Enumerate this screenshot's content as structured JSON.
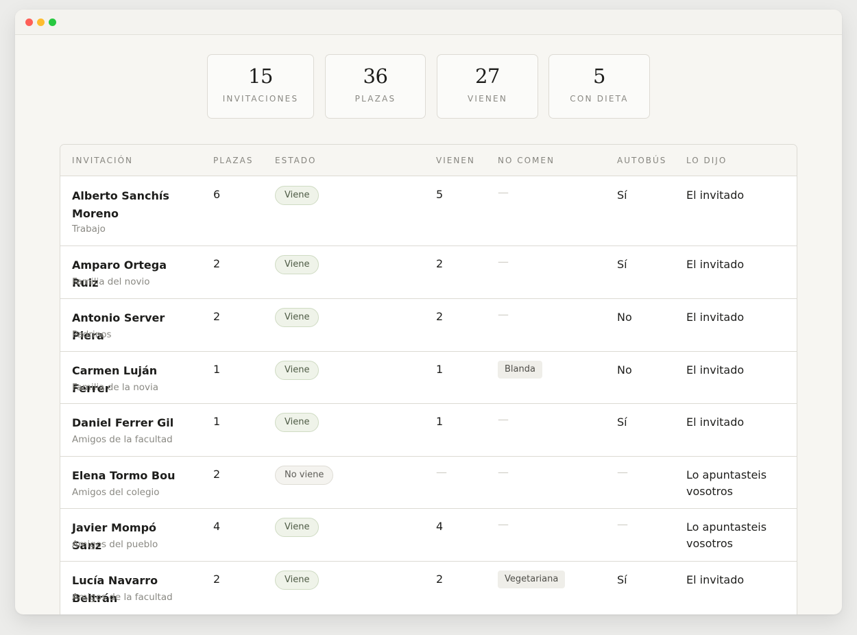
{
  "stats": [
    {
      "value": "15",
      "label": "INVITACIONES"
    },
    {
      "value": "36",
      "label": "PLAZAS"
    },
    {
      "value": "27",
      "label": "VIENEN"
    },
    {
      "value": "5",
      "label": "CON DIETA"
    }
  ],
  "table": {
    "headers": {
      "invitacion": "INVITACIÓN",
      "plazas": "PLAZAS",
      "estado": "ESTADO",
      "vienen": "VIENEN",
      "no_comen": "NO COMEN",
      "autobus": "AUTOBÚS",
      "lo_dijo": "LO DIJO"
    },
    "rows": [
      {
        "name": "Alberto Sanchís Moreno",
        "group": "Trabajo",
        "plazas": "6",
        "estado": "Viene",
        "vienen": "5",
        "no_comen": "—",
        "autobus": "Sí",
        "lo_dijo": "El invitado"
      },
      {
        "name": "Amparo Ortega Ruiz",
        "group": "Familia del novio",
        "plazas": "2",
        "estado": "Viene",
        "vienen": "2",
        "no_comen": "—",
        "autobus": "Sí",
        "lo_dijo": "El invitado"
      },
      {
        "name": "Antonio Server Piera",
        "group": "Padrinos",
        "plazas": "2",
        "estado": "Viene",
        "vienen": "2",
        "no_comen": "—",
        "autobus": "No",
        "lo_dijo": "El invitado"
      },
      {
        "name": "Carmen Luján Ferrer",
        "group": "Familia de la novia",
        "plazas": "1",
        "estado": "Viene",
        "vienen": "1",
        "no_comen": "Blanda",
        "autobus": "No",
        "lo_dijo": "El invitado"
      },
      {
        "name": "Daniel Ferrer Gil",
        "group": "Amigos de la facultad",
        "plazas": "1",
        "estado": "Viene",
        "vienen": "1",
        "no_comen": "—",
        "autobus": "Sí",
        "lo_dijo": "El invitado"
      },
      {
        "name": "Elena Tormo Bou",
        "group": "Amigos del colegio",
        "plazas": "2",
        "estado": "No viene",
        "vienen": "—",
        "no_comen": "—",
        "autobus": "—",
        "lo_dijo": "Lo apuntasteis vosotros"
      },
      {
        "name": "Javier Mompó Sanz",
        "group": "Amigos del pueblo",
        "plazas": "4",
        "estado": "Viene",
        "vienen": "4",
        "no_comen": "—",
        "autobus": "—",
        "lo_dijo": "Lo apuntasteis vosotros"
      },
      {
        "name": "Lucía Navarro Beltrán",
        "group": "Amigos de la facultad",
        "plazas": "2",
        "estado": "Viene",
        "vienen": "2",
        "no_comen": "Vegetariana",
        "autobus": "Sí",
        "lo_dijo": "El invitado"
      }
    ]
  }
}
